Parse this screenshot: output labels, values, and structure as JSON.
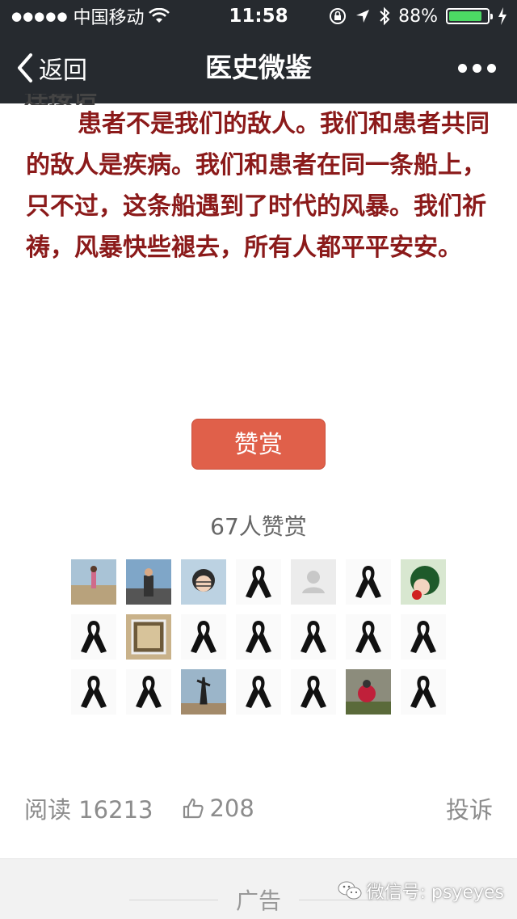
{
  "status": {
    "carrier": "中国移动",
    "time": "11:58",
    "battery": "88%",
    "battery_level": 0.88
  },
  "nav": {
    "back_label": "返回",
    "title": "医史微鉴"
  },
  "article": {
    "partial_top": "连接语",
    "paragraph": "患者不是我们的敌人。我们和患者共同的敌人是疾病。我们和患者在同一条船上，只不过，这条船遇到了时代的风暴。我们祈祷，风暴快些褪去，所有人都平平安安。"
  },
  "reward": {
    "button_label": "赞赏",
    "count_text": "67人赞赏"
  },
  "avatars": [
    "photo-beach",
    "photo-person",
    "photo-girl",
    "black-ribbon",
    "default-avatar",
    "black-ribbon",
    "photo-cartoon",
    "black-ribbon",
    "photo-frame",
    "black-ribbon",
    "black-ribbon",
    "black-ribbon",
    "black-ribbon",
    "black-ribbon",
    "black-ribbon",
    "black-ribbon",
    "photo-statue",
    "black-ribbon",
    "black-ribbon",
    "photo-red-figure",
    "black-ribbon"
  ],
  "stats": {
    "reads": "阅读 16213",
    "likes": "208",
    "report": "投诉"
  },
  "ad": {
    "label": "广告"
  },
  "watermark": {
    "text": "微信号: psyeyes"
  },
  "colors": {
    "accent": "#e0604a",
    "article_text": "#8b1a1a",
    "bar": "#262a2f"
  }
}
